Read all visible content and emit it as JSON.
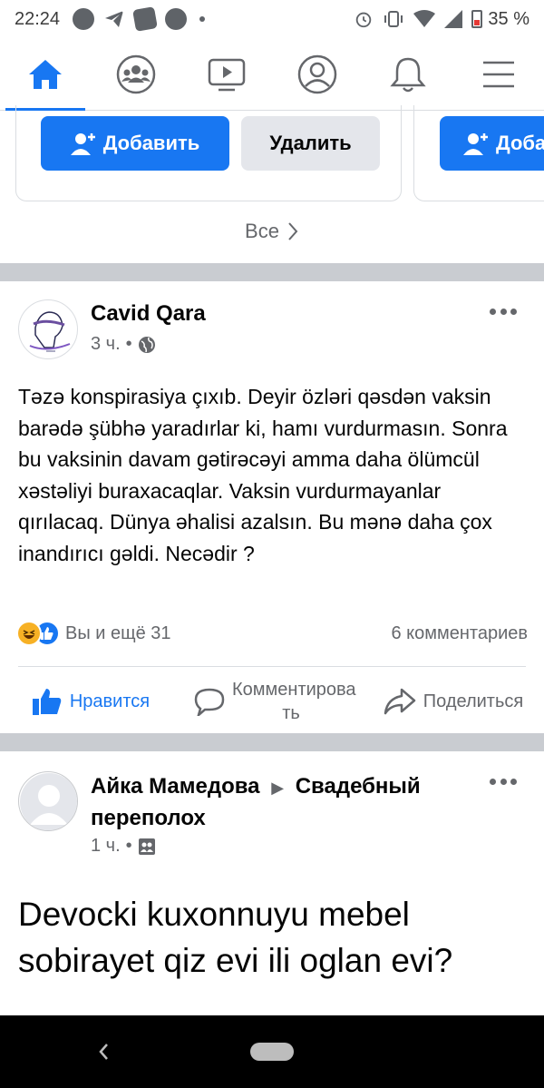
{
  "status_bar": {
    "time": "22:24",
    "battery": "35 %"
  },
  "nav": {
    "items": [
      {
        "name": "home",
        "icon": "home-icon",
        "active": true
      },
      {
        "name": "groups",
        "icon": "groups-icon"
      },
      {
        "name": "watch",
        "icon": "video-icon"
      },
      {
        "name": "profile",
        "icon": "profile-icon"
      },
      {
        "name": "notifications",
        "icon": "bell-icon"
      },
      {
        "name": "menu",
        "icon": "hamburger-icon"
      }
    ]
  },
  "suggestions": {
    "add_label": "Добавить",
    "add_label_partial": "Доба",
    "remove_label": "Удалить",
    "see_all": "Все"
  },
  "post1": {
    "author": "Cavid Qara",
    "time": "3 ч.",
    "privacy": "globe-icon",
    "text": "Təzə konspirasiya çıxıb. Deyir özləri qəsdən vaksin barədə şübhə yaradırlar ki, hamı vurdurmasın. Sonra bu vaksinin davam gətirəcəyi amma daha ölümcül xəstəliyi buraxacaqlar. Vaksin vurdurmayanlar qırılacaq. Dünya əhalisi azalsın. Bu mənə daha çox inandırıcı gəldi. Necədir ?",
    "reactions_text": "Вы и ещё 31",
    "comments_text": "6 комментариев",
    "actions": {
      "like": "Нравится",
      "comment": "Комментирова ть",
      "share": "Поделиться"
    }
  },
  "post2": {
    "author": "Айка Мамедова",
    "arrow": "▶",
    "group": "Свадебный переполох",
    "time": "1 ч.",
    "text": "Devocki kuxonnuyu mebel sobirayet qiz evi ili oglan evi?"
  },
  "colors": {
    "accent": "#1877f2",
    "separator": "#c9ccd1",
    "muted": "#65676b"
  }
}
